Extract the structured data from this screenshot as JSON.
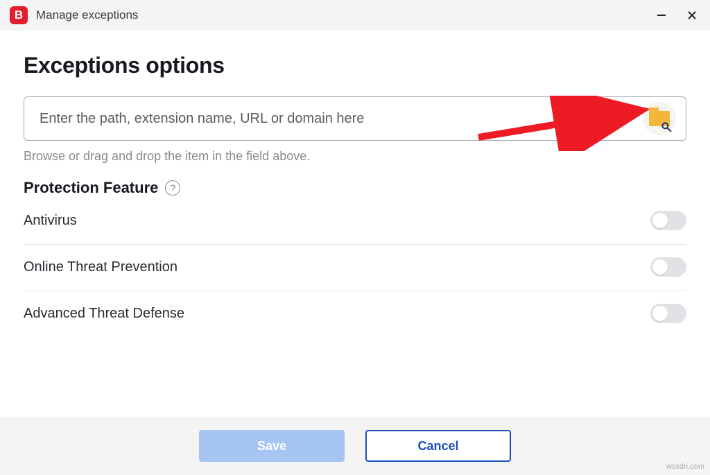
{
  "window": {
    "title": "Manage exceptions",
    "app_badge": "B"
  },
  "page": {
    "heading": "Exceptions options",
    "path_placeholder": "Enter the path, extension name, URL or domain here",
    "hint": "Browse or drag and drop the item in the field above.",
    "section_label": "Protection Feature"
  },
  "features": [
    {
      "label": "Antivirus",
      "enabled": false
    },
    {
      "label": "Online Threat Prevention",
      "enabled": false
    },
    {
      "label": "Advanced Threat Defense",
      "enabled": false
    }
  ],
  "footer": {
    "save": "Save",
    "cancel": "Cancel"
  },
  "watermark": "wsxdn.com",
  "colors": {
    "brand_red": "#e11d2e",
    "primary_blue": "#1a4fb3",
    "arrow_red": "#ed1c24"
  }
}
